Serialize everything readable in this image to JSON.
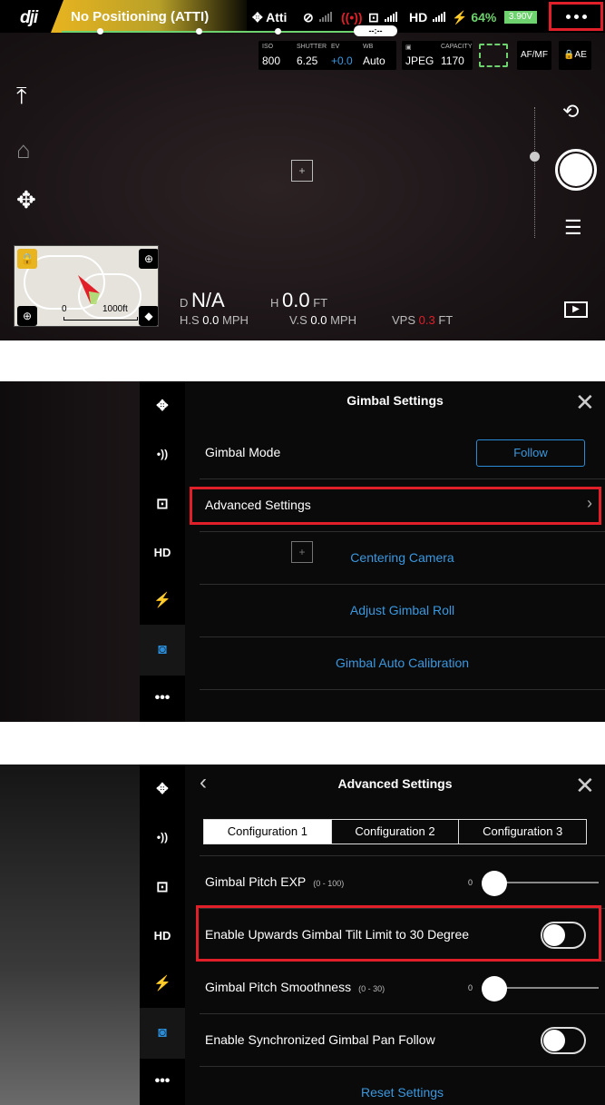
{
  "panel1": {
    "logo": "dji",
    "status": "No Positioning (ATTI)",
    "mode": "Atti",
    "hd": "HD",
    "battery_percent": "64%",
    "battery_voltage": "3.90V",
    "timer": "--:--",
    "camera": {
      "iso_label": "ISO",
      "iso_value": "800",
      "shutter_label": "SHUTTER",
      "shutter_value": "6.25",
      "ev_label": "EV",
      "ev_value": "+0.0",
      "wb_label": "WB",
      "wb_value": "Auto",
      "format_value": "JPEG",
      "capacity_label": "CAPACITY",
      "capacity_value": "1170",
      "afmf": "AF/MF",
      "ae": "AE"
    },
    "map": {
      "scale_start": "0",
      "scale_end": "1000ft"
    },
    "telemetry": {
      "d_label": "D",
      "d_value": "N/A",
      "h_label": "H",
      "h_value": "0.0",
      "h_unit": "FT",
      "hs_label": "H.S",
      "hs_value": "0.0",
      "hs_unit": "MPH",
      "vs_label": "V.S",
      "vs_value": "0.0",
      "vs_unit": "MPH",
      "vps_label": "VPS",
      "vps_value": "0.3",
      "vps_unit": "FT"
    },
    "colors": {
      "accent_green": "#6ed36e",
      "alert_red": "#e01f28"
    }
  },
  "side_menu": {
    "items": [
      {
        "icon": "aircraft-icon",
        "glyph": "✥"
      },
      {
        "icon": "signal-icon",
        "glyph": "•))"
      },
      {
        "icon": "remote-controller-icon",
        "glyph": "⊡"
      },
      {
        "icon": "hd-icon",
        "glyph": "HD"
      },
      {
        "icon": "battery-icon",
        "glyph": "⚡"
      },
      {
        "icon": "gimbal-camera-icon",
        "glyph": "◙"
      },
      {
        "icon": "more-icon",
        "glyph": "•••"
      }
    ]
  },
  "gimbal_settings": {
    "title": "Gimbal Settings",
    "gimbal_mode_label": "Gimbal Mode",
    "follow_button": "Follow",
    "advanced_settings": "Advanced Settings",
    "centering_camera": "Centering Camera",
    "adjust_roll": "Adjust Gimbal Roll",
    "auto_calibration": "Gimbal Auto Calibration"
  },
  "advanced_settings": {
    "title": "Advanced Settings",
    "tabs": [
      "Configuration 1",
      "Configuration 2",
      "Configuration 3"
    ],
    "selected_tab": 0,
    "pitch_exp_label": "Gimbal Pitch EXP",
    "pitch_exp_range": "(0 - 100)",
    "pitch_exp_value": "0",
    "tilt_limit_label": "Enable Upwards Gimbal Tilt Limit to 30 Degree",
    "tilt_limit_on": false,
    "smoothness_label": "Gimbal Pitch Smoothness",
    "smoothness_range": "(0 - 30)",
    "smoothness_value": "0",
    "sync_pan_label": "Enable Synchronized Gimbal Pan Follow",
    "sync_pan_on": false,
    "reset": "Reset Settings"
  }
}
